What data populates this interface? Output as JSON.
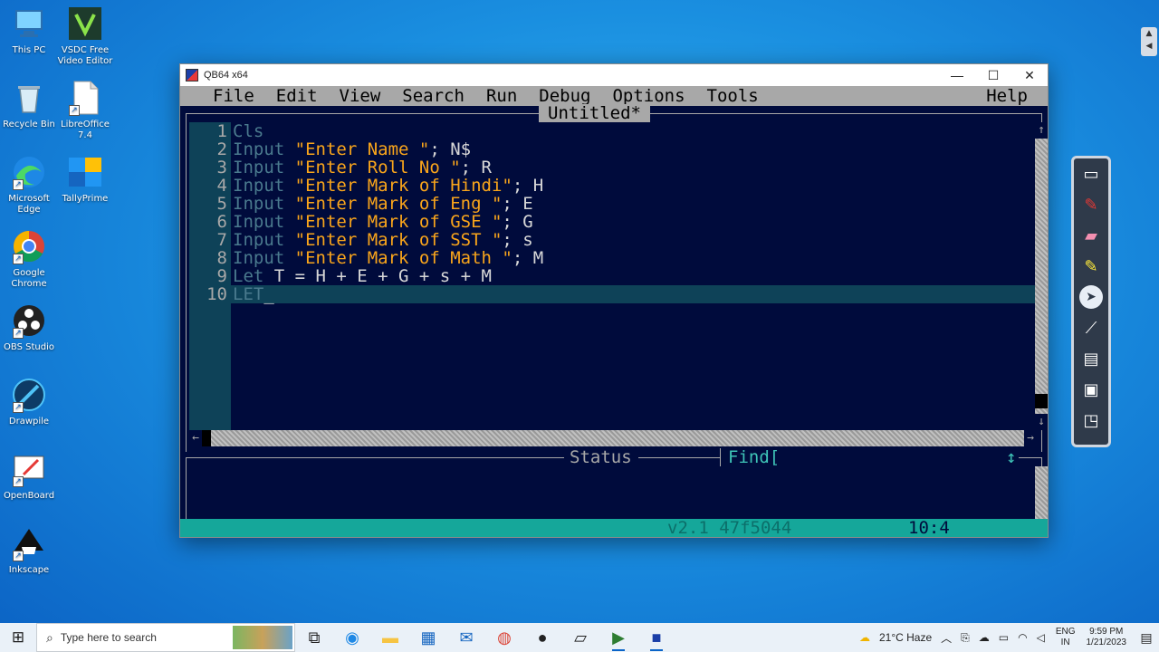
{
  "desktop": {
    "icons": [
      {
        "label": "This PC"
      },
      {
        "label": "VSDC Free Video Editor"
      },
      {
        "label": "Recycle Bin"
      },
      {
        "label": "LibreOffice 7.4"
      },
      {
        "label": "Microsoft Edge"
      },
      {
        "label": "TallyPrime"
      },
      {
        "label": "Google Chrome"
      },
      {
        "label": "OBS Studio"
      },
      {
        "label": "Drawpile"
      },
      {
        "label": "OpenBoard"
      },
      {
        "label": "Inkscape"
      }
    ]
  },
  "window": {
    "title": "QB64 x64",
    "controls": {
      "minimize": "—",
      "maximize": "☐",
      "close": "✕"
    },
    "menu": [
      "File",
      "Edit",
      "View",
      "Search",
      "Run",
      "Debug",
      "Options",
      "Tools"
    ],
    "help": "Help",
    "doc_title": "Untitled*",
    "code_lines": [
      {
        "num": "1",
        "kw": "Cls",
        "str": "",
        "rest": ""
      },
      {
        "num": "2",
        "kw": "Input ",
        "str": "\"Enter Name \"",
        "rest": "; N$"
      },
      {
        "num": "3",
        "kw": "Input ",
        "str": "\"Enter Roll No \"",
        "rest": "; R"
      },
      {
        "num": "4",
        "kw": "Input ",
        "str": "\"Enter Mark of Hindi\"",
        "rest": "; H"
      },
      {
        "num": "5",
        "kw": "Input ",
        "str": "\"Enter Mark of Eng \"",
        "rest": "; E"
      },
      {
        "num": "6",
        "kw": "Input ",
        "str": "\"Enter Mark of GSE \"",
        "rest": "; G"
      },
      {
        "num": "7",
        "kw": "Input ",
        "str": "\"Enter Mark of SST \"",
        "rest": "; s"
      },
      {
        "num": "8",
        "kw": "Input ",
        "str": "\"Enter Mark of Math \"",
        "rest": "; M"
      },
      {
        "num": "9",
        "kw": "Let ",
        "str": "",
        "rest": "T = H + E + G + s + M"
      },
      {
        "num": "10",
        "kw": "LET",
        "str": "",
        "rest": "_"
      }
    ],
    "status_label": "Status",
    "find_label": "Find[",
    "status_arrow": "↕",
    "version": "v2.1 47f5044",
    "cursor_position": "10:4"
  },
  "taskbar": {
    "search_placeholder": "Type here to search",
    "weather": "21°C  Haze",
    "language": [
      "ENG",
      "IN"
    ],
    "time": "9:59 PM",
    "date": "1/21/2023"
  }
}
